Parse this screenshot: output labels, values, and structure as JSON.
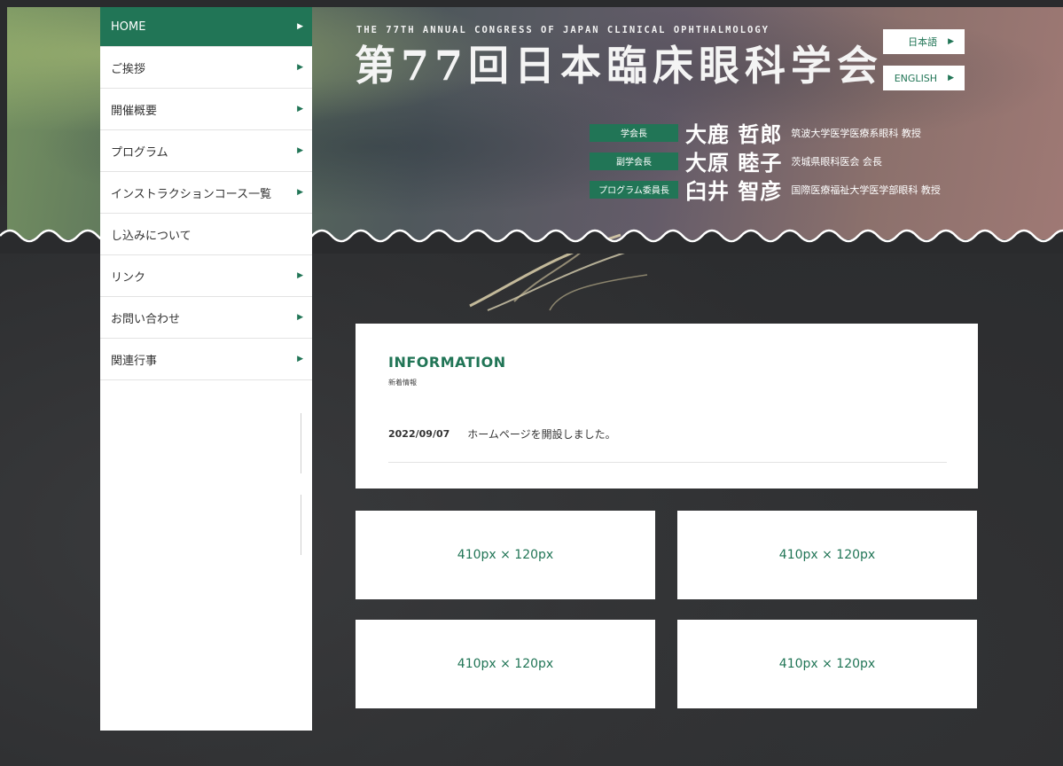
{
  "header": {
    "congress_en": "THE 77TH ANNUAL CONGRESS OF JAPAN CLINICAL OPHTHALMOLOGY",
    "congress_jp": "第77回日本臨床眼科学会",
    "lang_buttons": [
      {
        "label": "日本語"
      },
      {
        "label": "ENGLISH"
      }
    ],
    "officers": [
      {
        "role": "学会長",
        "name": "大鹿 哲郎",
        "affiliation": "筑波大学医学医療系眼科 教授"
      },
      {
        "role": "副学会長",
        "name": "大原 睦子",
        "affiliation": "茨城県眼科医会 会長"
      },
      {
        "role": "プログラム委員長",
        "name": "臼井 智彦",
        "affiliation": "国際医療福祉大学医学部眼科 教授"
      }
    ]
  },
  "sidebar": {
    "items": [
      {
        "label": "HOME"
      },
      {
        "label": "ご挨拶"
      },
      {
        "label": "開催概要"
      },
      {
        "label": "プログラム"
      },
      {
        "label": "インストラクションコース一覧"
      },
      {
        "label": "し込みについて"
      },
      {
        "label": "リンク"
      },
      {
        "label": "お問い合わせ"
      },
      {
        "label": "関連行事"
      }
    ]
  },
  "information": {
    "title": "INFORMATION",
    "subtitle": "新着情報",
    "entries": [
      {
        "date": "2022/09/07",
        "text": "ホームページを開設しました。"
      }
    ]
  },
  "banners": [
    {
      "label": "410px × 120px"
    },
    {
      "label": "410px × 120px"
    },
    {
      "label": "410px × 120px"
    },
    {
      "label": "410px × 120px"
    }
  ],
  "colors": {
    "accent": "#217556",
    "background": "#2b2c2e",
    "panel": "#ffffff"
  },
  "icons": {
    "nav_arrow": "caret-right-icon"
  }
}
